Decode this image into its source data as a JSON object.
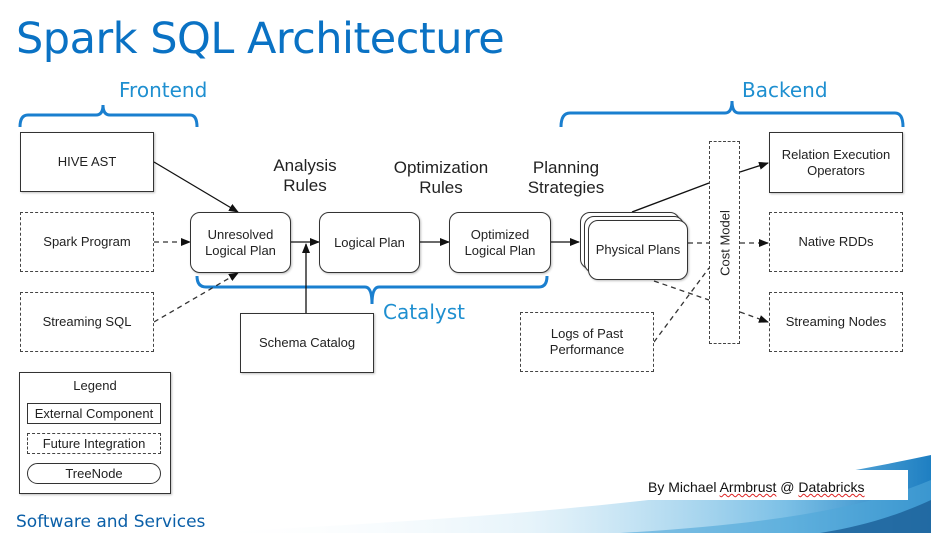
{
  "title": "Spark SQL Architecture",
  "sections": {
    "frontend": "Frontend",
    "backend": "Backend",
    "catalyst": "Catalyst"
  },
  "rule_labels": {
    "analysis": [
      "Analysis",
      "Rules"
    ],
    "optimization": [
      "Optimization",
      "Rules"
    ],
    "planning": [
      "Planning",
      "Strategies"
    ]
  },
  "inputs": {
    "hive_ast": "HIVE AST",
    "spark_program": "Spark Program",
    "streaming_sql": "Streaming SQL"
  },
  "catalyst_nodes": {
    "unresolved": [
      "Unresolved",
      "Logical Plan"
    ],
    "logical": "Logical Plan",
    "optimized": [
      "Optimized",
      "Logical Plan"
    ]
  },
  "schema_catalog": "Schema Catalog",
  "physical_plans": "Physical Plans",
  "logs": [
    "Logs of Past",
    "Performance"
  ],
  "cost_model": "Cost Model",
  "outputs": {
    "relation": [
      "Relation Execution",
      "Operators"
    ],
    "native_rdds": "Native RDDs",
    "streaming_nodes": "Streaming Nodes"
  },
  "legend": {
    "title": "Legend",
    "external": "External Component",
    "future": "Future Integration",
    "treenode": "TreeNode"
  },
  "footer": {
    "left": "Software and Services",
    "credit_prefix": "By Michael ",
    "credit_name": "Armbrust",
    "credit_at": " @ ",
    "credit_company": "Databricks"
  },
  "colors": {
    "title": "#0a72c4",
    "brace": "#1a7fcf",
    "brace_label": "#1e8fd0"
  }
}
